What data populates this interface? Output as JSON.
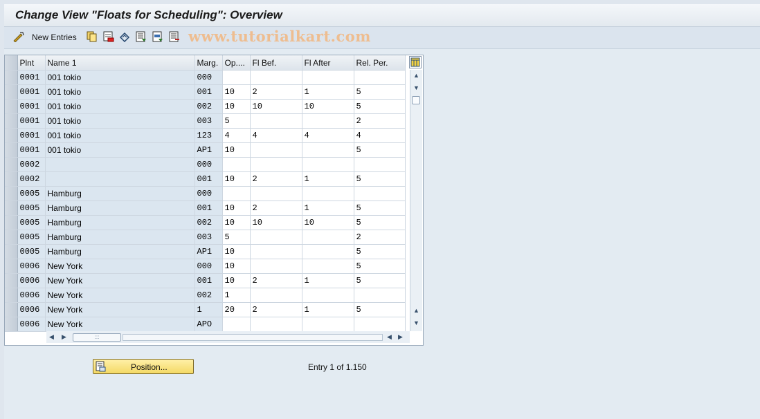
{
  "window": {
    "title": "Change View \"Floats for Scheduling\": Overview"
  },
  "toolbar": {
    "new_entries_label": "New Entries",
    "icons": [
      "edit-glasses-icon",
      "copy-icon",
      "delete-icon",
      "undo-icon",
      "select-all-icon",
      "select-block-icon",
      "deselect-all-icon"
    ],
    "watermark": "www.tutorialkart.com"
  },
  "table": {
    "columns": [
      "Plnt",
      "Name 1",
      "Marg.",
      "Op....",
      "Fl Bef.",
      "Fl After",
      "Rel. Per."
    ],
    "rows": [
      {
        "plnt": "0001",
        "name": "001 tokio",
        "marg": "000",
        "op": "",
        "flbef": "",
        "flafter": "",
        "relper": ""
      },
      {
        "plnt": "0001",
        "name": "001 tokio",
        "marg": "001",
        "op": "10",
        "flbef": "2",
        "flafter": "1",
        "relper": "5"
      },
      {
        "plnt": "0001",
        "name": "001 tokio",
        "marg": "002",
        "op": "10",
        "flbef": "10",
        "flafter": "10",
        "relper": "5"
      },
      {
        "plnt": "0001",
        "name": "001 tokio",
        "marg": "003",
        "op": "5",
        "flbef": "",
        "flafter": "",
        "relper": "2"
      },
      {
        "plnt": "0001",
        "name": "001 tokio",
        "marg": "123",
        "op": "4",
        "flbef": "4",
        "flafter": "4",
        "relper": "4"
      },
      {
        "plnt": "0001",
        "name": "001 tokio",
        "marg": "AP1",
        "op": "10",
        "flbef": "",
        "flafter": "",
        "relper": "5"
      },
      {
        "plnt": "0002",
        "name": "",
        "marg": "000",
        "op": "",
        "flbef": "",
        "flafter": "",
        "relper": ""
      },
      {
        "plnt": "0002",
        "name": "",
        "marg": "001",
        "op": "10",
        "flbef": "2",
        "flafter": "1",
        "relper": "5"
      },
      {
        "plnt": "0005",
        "name": "Hamburg",
        "marg": "000",
        "op": "",
        "flbef": "",
        "flafter": "",
        "relper": ""
      },
      {
        "plnt": "0005",
        "name": "Hamburg",
        "marg": "001",
        "op": "10",
        "flbef": "2",
        "flafter": "1",
        "relper": "5"
      },
      {
        "plnt": "0005",
        "name": "Hamburg",
        "marg": "002",
        "op": "10",
        "flbef": "10",
        "flafter": "10",
        "relper": "5"
      },
      {
        "plnt": "0005",
        "name": "Hamburg",
        "marg": "003",
        "op": "5",
        "flbef": "",
        "flafter": "",
        "relper": "2"
      },
      {
        "plnt": "0005",
        "name": "Hamburg",
        "marg": "AP1",
        "op": "10",
        "flbef": "",
        "flafter": "",
        "relper": "5"
      },
      {
        "plnt": "0006",
        "name": "New York",
        "marg": "000",
        "op": "10",
        "flbef": "",
        "flafter": "",
        "relper": "5"
      },
      {
        "plnt": "0006",
        "name": "New York",
        "marg": "001",
        "op": "10",
        "flbef": "2",
        "flafter": "1",
        "relper": "5"
      },
      {
        "plnt": "0006",
        "name": "New York",
        "marg": "002",
        "op": "1",
        "flbef": "",
        "flafter": "",
        "relper": ""
      },
      {
        "plnt": "0006",
        "name": "New York",
        "marg": "1",
        "op": "20",
        "flbef": "2",
        "flafter": "1",
        "relper": "5"
      },
      {
        "plnt": "0006",
        "name": "New York",
        "marg": "APO",
        "op": "",
        "flbef": "",
        "flafter": "",
        "relper": ""
      }
    ]
  },
  "position_button_label": "Position...",
  "entry_info": "Entry 1 of 1.150"
}
